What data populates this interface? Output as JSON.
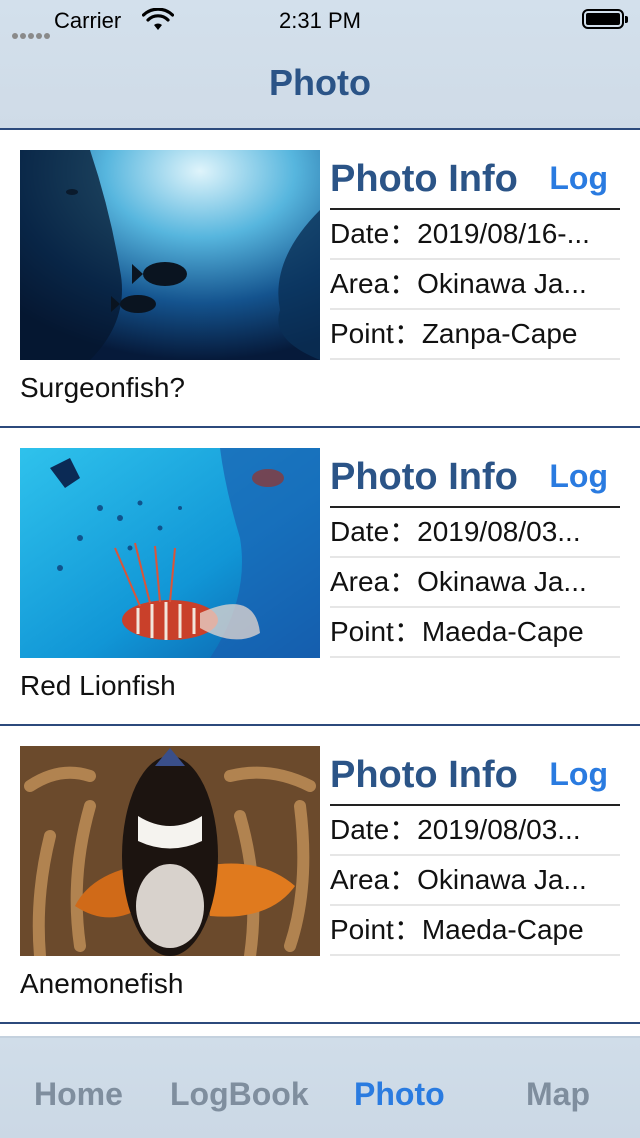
{
  "status_bar": {
    "carrier": "Carrier",
    "time": "2:31 PM"
  },
  "nav": {
    "title": "Photo"
  },
  "photos": [
    {
      "info_title": "Photo Info",
      "log_label": "Log",
      "date": "Date：2019/08/16-...",
      "area": "Area：Okinawa Ja...",
      "point": "Point：Zanpa-Cape",
      "caption": "Surgeonfish?"
    },
    {
      "info_title": "Photo Info",
      "log_label": "Log",
      "date": "Date：2019/08/03...",
      "area": "Area：Okinawa Ja...",
      "point": "Point：Maeda-Cape",
      "caption": "Red Lionfish"
    },
    {
      "info_title": "Photo Info",
      "log_label": "Log",
      "date": "Date：2019/08/03...",
      "area": "Area：Okinawa Ja...",
      "point": "Point：Maeda-Cape",
      "caption": "Anemonefish"
    }
  ],
  "tabs": [
    {
      "label": "Home",
      "active": false
    },
    {
      "label": "LogBook",
      "active": false
    },
    {
      "label": "Photo",
      "active": true
    },
    {
      "label": "Map",
      "active": false
    }
  ],
  "colors": {
    "accent": "#2a7be0",
    "title": "#2b5487",
    "separator": "#2c4a7c",
    "tab_inactive": "#7f8e9e"
  },
  "icons": [
    "wifi-icon",
    "battery-icon",
    "signal-icon"
  ]
}
